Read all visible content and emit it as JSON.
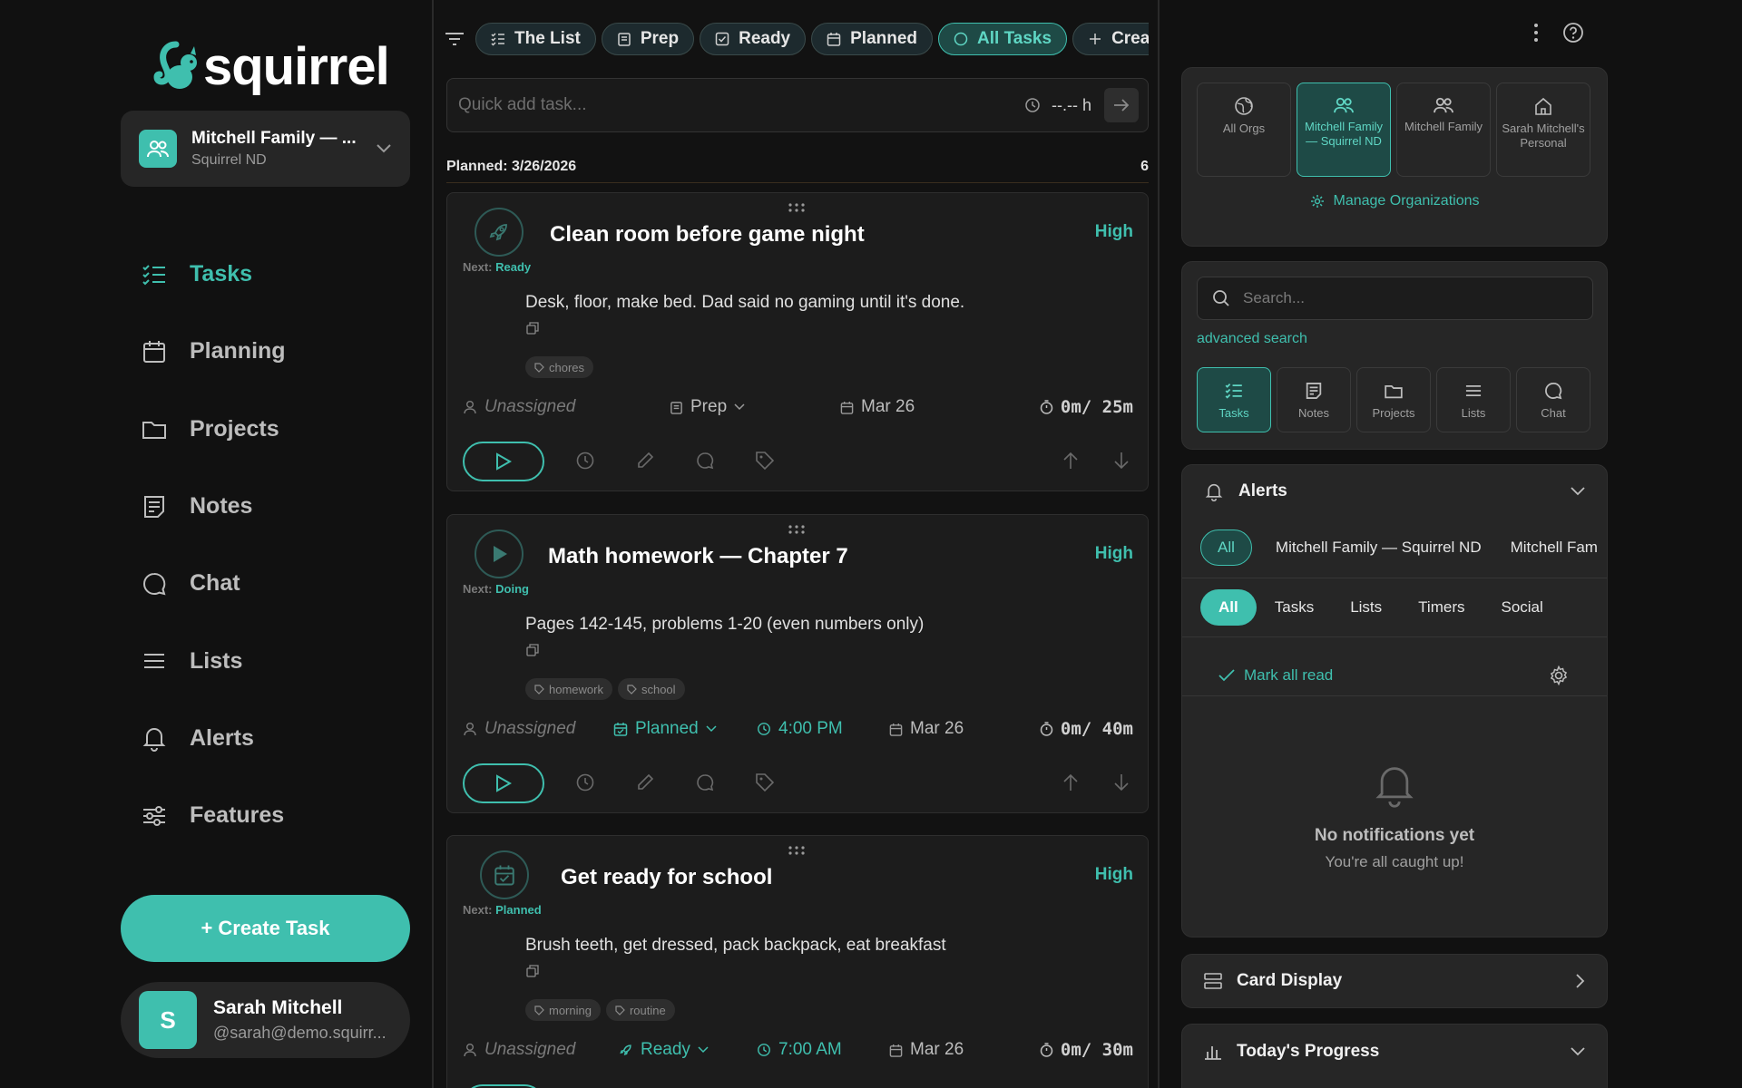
{
  "brand": {
    "name": "squirrel"
  },
  "org": {
    "name": "Mitchell Family — ...",
    "sub": "Squirrel ND"
  },
  "nav": [
    {
      "id": "tasks",
      "label": "Tasks",
      "icon": "tasks-icon"
    },
    {
      "id": "planning",
      "label": "Planning",
      "icon": "calendar-icon"
    },
    {
      "id": "projects",
      "label": "Projects",
      "icon": "folder-icon"
    },
    {
      "id": "notes",
      "label": "Notes",
      "icon": "note-icon"
    },
    {
      "id": "chat",
      "label": "Chat",
      "icon": "chat-icon"
    },
    {
      "id": "lists",
      "label": "Lists",
      "icon": "list-icon"
    },
    {
      "id": "alerts",
      "label": "Alerts",
      "icon": "bell-icon"
    },
    {
      "id": "features",
      "label": "Features",
      "icon": "sliders-icon"
    }
  ],
  "create_task_label": "+ Create Task",
  "user": {
    "initial": "S",
    "name": "Sarah Mitchell",
    "handle": "@sarah@demo.squirr..."
  },
  "tabs": [
    {
      "label": "The List",
      "icon": "list-check-icon"
    },
    {
      "label": "Prep",
      "icon": "clipboard-icon"
    },
    {
      "label": "Ready",
      "icon": "check-square-icon"
    },
    {
      "label": "Planned",
      "icon": "calendar-icon"
    },
    {
      "label": "All Tasks",
      "icon": "circle-icon",
      "active": true
    },
    {
      "label": "Creat",
      "icon": "plus-icon"
    }
  ],
  "quick_add": {
    "placeholder": "Quick add task...",
    "time": "--.-- h"
  },
  "planned_header": {
    "label": "Planned: 3/26/2026",
    "count": "6"
  },
  "tasks": [
    {
      "title": "Clean room before game night",
      "priority": "High",
      "next_prefix": "Next: ",
      "next": "Ready",
      "status_icon": "rocket-icon",
      "description": "Desk, floor, make bed. Dad said no gaming until it's done.",
      "tags": [
        "chores"
      ],
      "assignee": "Unassigned",
      "status": "Prep",
      "status_style": "muted",
      "time": "",
      "date": "Mar 26",
      "duration": "0m/ 25m"
    },
    {
      "title": "Math homework — Chapter 7",
      "priority": "High",
      "next_prefix": "Next: ",
      "next": "Doing",
      "status_icon": "play-icon",
      "description": "Pages 142-145, problems 1-20 (even numbers only)",
      "tags": [
        "homework",
        "school"
      ],
      "assignee": "Unassigned",
      "status": "Planned",
      "status_style": "teal",
      "time": "4:00 PM",
      "date": "Mar 26",
      "duration": "0m/ 40m"
    },
    {
      "title": "Get ready for school",
      "priority": "High",
      "next_prefix": "Next: ",
      "next": "Planned",
      "status_icon": "calendar-check-icon",
      "description": "Brush teeth, get dressed, pack backpack, eat breakfast",
      "tags": [
        "morning",
        "routine"
      ],
      "assignee": "Unassigned",
      "status": "Ready",
      "status_style": "teal",
      "time": "7:00 AM",
      "date": "Mar 26",
      "duration": "0m/ 30m"
    }
  ],
  "org_switcher": [
    {
      "label": "All Orgs",
      "icon": "globe-icon"
    },
    {
      "label": "Mitchell Family — Squirrel ND",
      "icon": "users-icon",
      "active": true
    },
    {
      "label": "Mitchell Family",
      "icon": "users-icon"
    },
    {
      "label": "Sarah Mitchell's Personal",
      "icon": "home-icon"
    }
  ],
  "manage_orgs_label": "Manage Organizations",
  "search": {
    "placeholder": "Search...",
    "advanced": "advanced search"
  },
  "quick_nav": [
    {
      "label": "Tasks",
      "icon": "tasks-icon",
      "active": true
    },
    {
      "label": "Notes",
      "icon": "note-icon"
    },
    {
      "label": "Projects",
      "icon": "folder-icon"
    },
    {
      "label": "Lists",
      "icon": "list-icon"
    },
    {
      "label": "Chat",
      "icon": "chat-icon"
    }
  ],
  "alerts": {
    "title": "Alerts",
    "org_filters": [
      "All",
      "Mitchell Family — Squirrel ND",
      "Mitchell Fam"
    ],
    "type_filters": [
      "All",
      "Tasks",
      "Lists",
      "Timers",
      "Social"
    ],
    "mark_all_read": "Mark all read",
    "empty_title": "No notifications yet",
    "empty_sub": "You're all caught up!"
  },
  "card_display_label": "Card Display",
  "todays_progress_label": "Today's Progress",
  "colors": {
    "accent": "#3fbfae",
    "background": "#111111",
    "card": "#1c1c1c",
    "panel": "#262626"
  }
}
